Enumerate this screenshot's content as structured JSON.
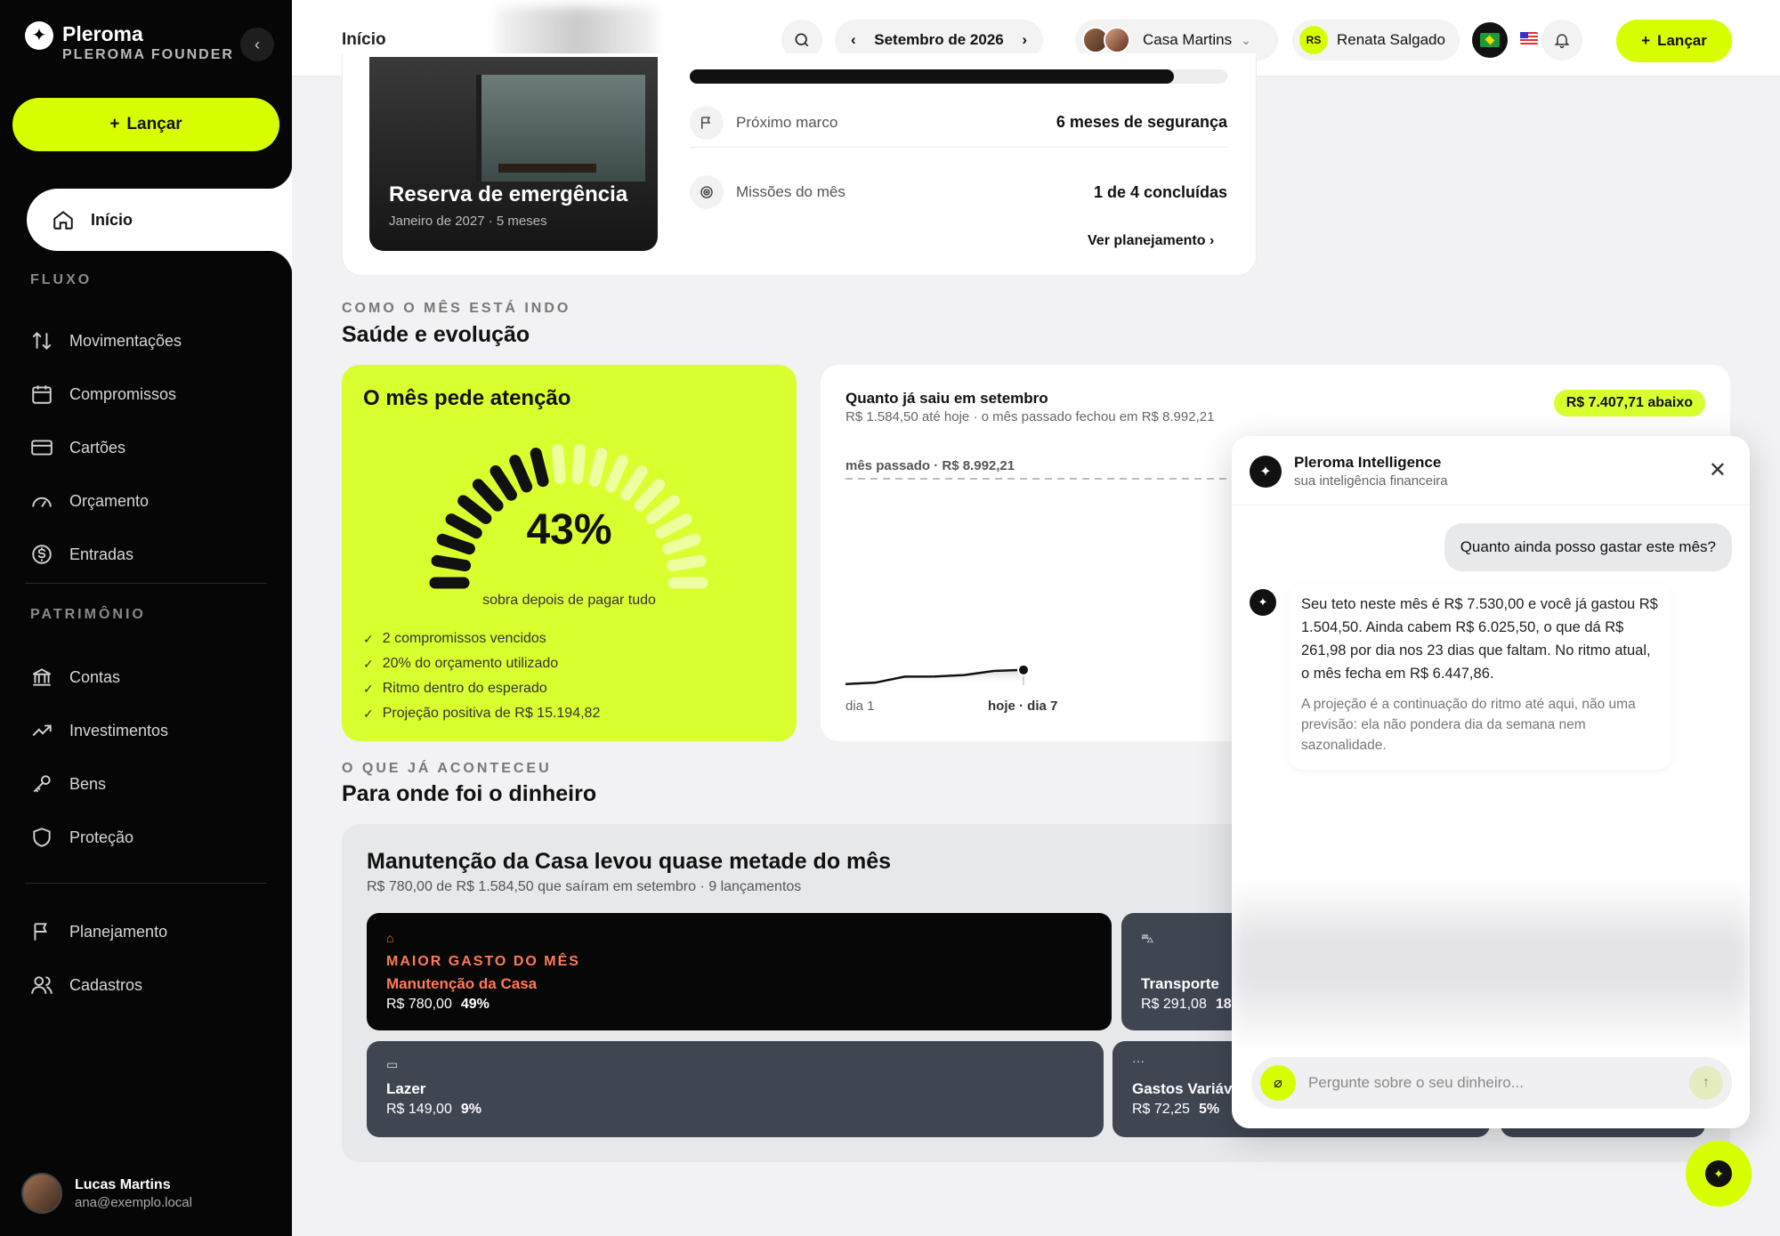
{
  "sidebar": {
    "brand_name": "Pleroma",
    "brand_sub": "PLEROMA FOUNDER",
    "launch_label": "Lançar",
    "active_item": "Início",
    "section_fluxo": "FLUXO",
    "section_patrimonio": "PATRIMÔNIO",
    "fluxo_items": [
      "Movimentações",
      "Compromissos",
      "Cartões",
      "Orçamento",
      "Entradas"
    ],
    "patrimonio_items": [
      "Contas",
      "Investimentos",
      "Bens",
      "Proteção"
    ],
    "other_items": [
      "Planejamento",
      "Cadastros"
    ],
    "user_name": "Lucas Martins",
    "user_email": "ana@exemplo.local"
  },
  "topbar": {
    "page_title": "Início",
    "month": "Setembro de 2026",
    "household": "Casa Martins",
    "user_initials": "RS",
    "user_name": "Renata Salgado",
    "launch_label": "Lançar"
  },
  "goal_card": {
    "title": "Reserva de emergência",
    "subtitle": "Janeiro de 2027 · 5 meses",
    "progress": 0.9,
    "next_milestone_label": "Próximo marco",
    "next_milestone_value": "6 meses de segurança",
    "missions_label": "Missões do mês",
    "missions_value": "1 de 4 concluídas",
    "link": "Ver planejamento"
  },
  "health": {
    "kicker": "COMO O MÊS ESTÁ INDO",
    "title": "Saúde e evolução",
    "status_title": "O mês pede atenção",
    "percent_label": "43%",
    "percent_value": 43,
    "percent_caption": "sobra depois de pagar tudo",
    "checks": [
      "2 compromissos vencidos",
      "20% do orçamento utilizado",
      "Ritmo dentro do esperado",
      "Projeção positiva de R$ 15.194,82"
    ]
  },
  "spending_chart": {
    "title": "Quanto já saiu em setembro",
    "subtitle": "R$ 1.584,50 até hoje · o mês passado fechou em R$ 8.992,21",
    "badge": "R$ 7.407,71 abaixo",
    "reference_label": "mês passado · R$ 8.992,21",
    "x_start_label": "dia 1",
    "x_today_label": "hoje · dia 7"
  },
  "chart_data": {
    "type": "area",
    "x": [
      1,
      2,
      3,
      4,
      5,
      6,
      7
    ],
    "values": [
      120,
      260,
      890,
      900,
      1050,
      1480,
      1584.5
    ],
    "reference_line": 8992.21,
    "xlabel": "",
    "ylabel": ""
  },
  "money": {
    "kicker": "O QUE JÁ ACONTECEU",
    "title": "Para onde foi o dinheiro",
    "card_title": "Manutenção da Casa levou quase metade do mês",
    "card_sub": "R$ 780,00 de R$ 1.584,50 que saíram em setembro · 9 lançamentos",
    "top_label": "MAIOR GASTO DO MÊS",
    "top_name": "Manutenção da Casa",
    "top_value": "R$ 780,00",
    "top_pct": "49%",
    "transporte_name": "Transporte",
    "transporte_value": "R$ 291,08",
    "transporte_pct": "18%",
    "lazer_name": "Lazer",
    "lazer_value": "R$ 149,00",
    "lazer_pct": "9%",
    "variaveis_name": "Gastos Variáv",
    "variaveis_value": "R$ 72,25",
    "variaveis_pct": "5%"
  },
  "chat": {
    "name": "Pleroma Intelligence",
    "tagline": "sua inteligência financeira",
    "user_msg": "Quanto ainda posso gastar este mês?",
    "bot_msg": "Seu teto neste mês é R$ 7.530,00 e você já gastou R$ 1.504,50. Ainda cabem R$ 6.025,50, o que dá R$ 261,98 por dia nos 23 dias que faltam. No ritmo atual, o mês fecha em R$ 6.447,86.",
    "bot_note": "A projeção é a continuação do ritmo até aqui, não uma previsão: ela não pondera dia da semana nem sazonalidade.",
    "input_placeholder": "Pergunte sobre o seu dinheiro..."
  },
  "colors": {
    "accent": "#d8ff00",
    "sidebar_bg": "#060606",
    "highlight_text": "#ff7a59",
    "tile_dark": "#3f4652"
  }
}
